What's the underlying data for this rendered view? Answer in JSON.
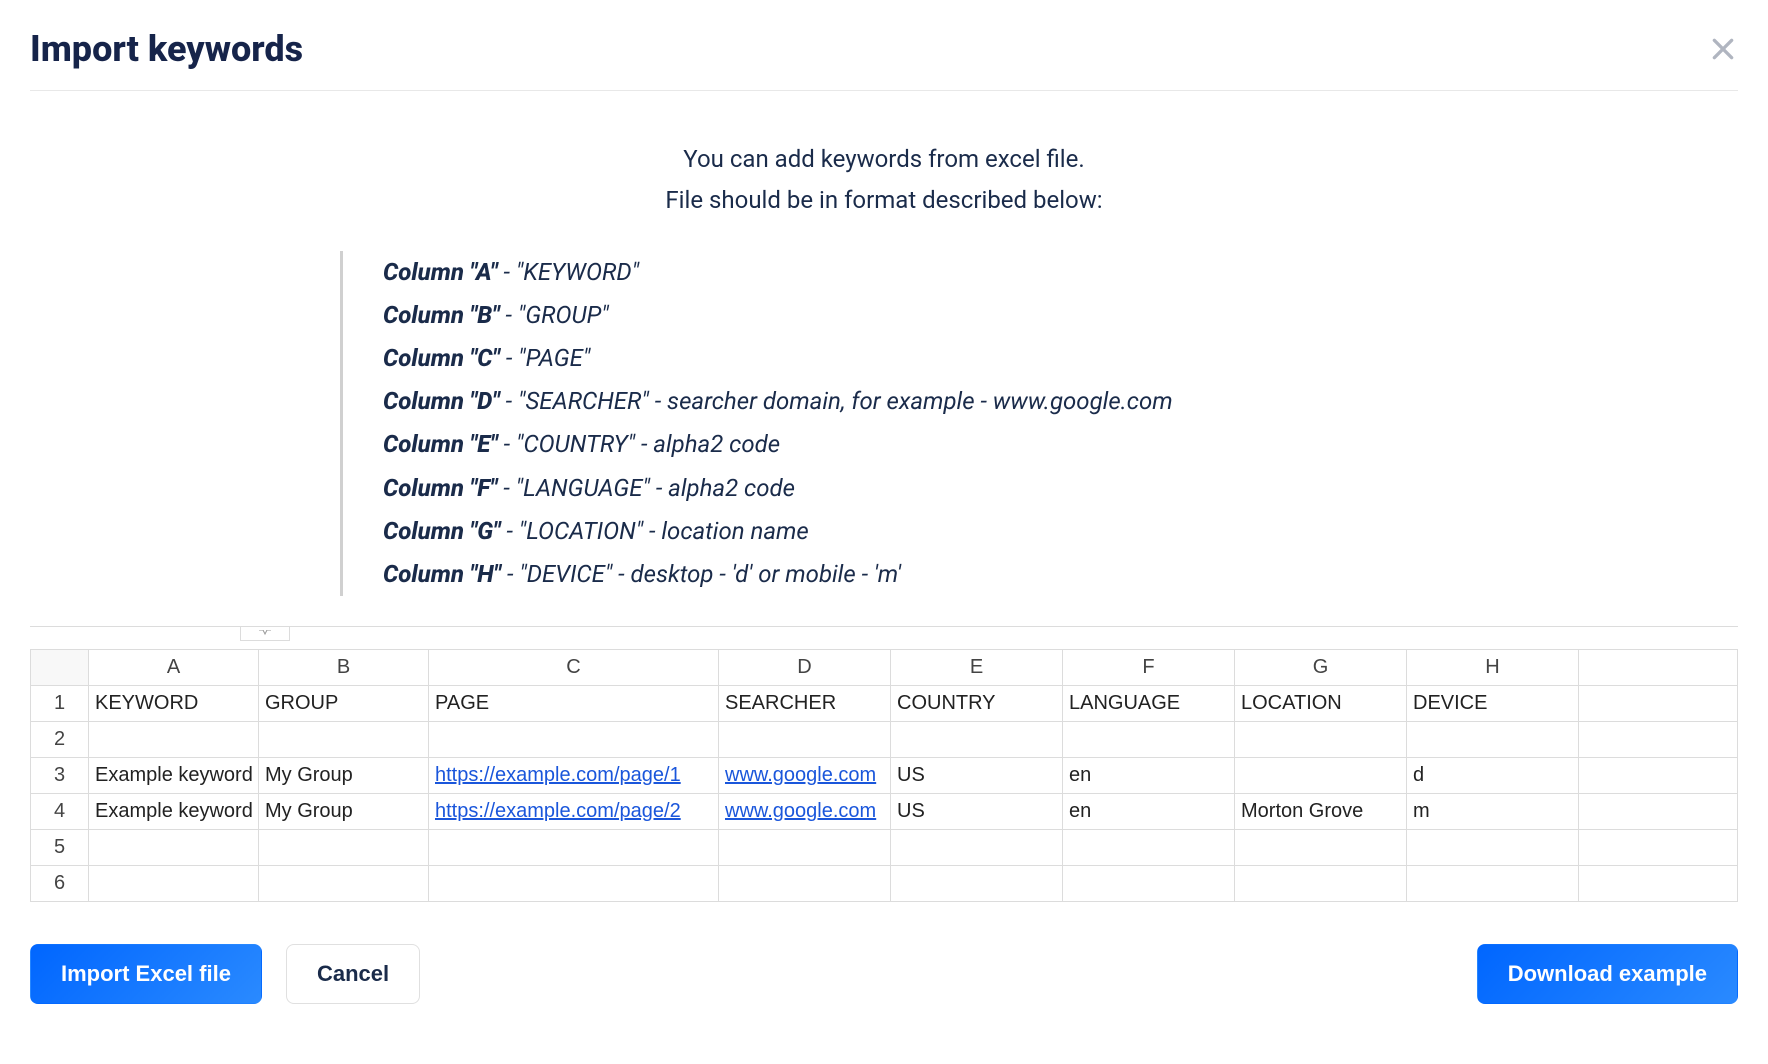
{
  "header": {
    "title": "Import keywords"
  },
  "intro": {
    "line1": "You can add keywords from excel file.",
    "line2": "File should be in format described below:"
  },
  "format": [
    {
      "col": "Column \"A\"",
      "desc": "\"KEYWORD\""
    },
    {
      "col": "Column \"B\"",
      "desc": "\"GROUP\""
    },
    {
      "col": "Column \"C\"",
      "desc": "\"PAGE\""
    },
    {
      "col": "Column \"D\"",
      "desc": "\"SEARCHER\" - searcher domain, for example - www.google.com"
    },
    {
      "col": "Column \"E\"",
      "desc": "\"COUNTRY\" - alpha2 code"
    },
    {
      "col": "Column \"F\"",
      "desc": "\"LANGUAGE\" - alpha2 code"
    },
    {
      "col": "Column \"G\"",
      "desc": "\"LOCATION\" - location name"
    },
    {
      "col": "Column \"H\"",
      "desc": "\"DEVICE\" - desktop - 'd' or mobile - 'm'"
    }
  ],
  "sheet": {
    "colHeaders": [
      "A",
      "B",
      "C",
      "D",
      "E",
      "F",
      "G",
      "H"
    ],
    "rowNums": [
      "1",
      "2",
      "3",
      "4",
      "5",
      "6"
    ],
    "rows": [
      {
        "A": "KEYWORD",
        "B": "GROUP",
        "C": "PAGE",
        "D": "SEARCHER",
        "E": "COUNTRY",
        "F": "LANGUAGE",
        "G": "LOCATION",
        "H": "DEVICE"
      },
      {
        "A": "",
        "B": "",
        "C": "",
        "D": "",
        "E": "",
        "F": "",
        "G": "",
        "H": ""
      },
      {
        "A": "Example keyword",
        "B": "My Group",
        "C": "https://example.com/page/1",
        "D": "www.google.com",
        "E": "US",
        "F": "en",
        "G": "",
        "H": "d",
        "linkC": true,
        "linkD": true
      },
      {
        "A": "Example keyword",
        "B": "My Group",
        "C": "https://example.com/page/2",
        "D": "www.google.com",
        "E": "US",
        "F": "en",
        "G": "Morton Grove",
        "H": "m",
        "linkC": true,
        "linkD": true
      },
      {
        "A": "",
        "B": "",
        "C": "",
        "D": "",
        "E": "",
        "F": "",
        "G": "",
        "H": ""
      },
      {
        "A": "",
        "B": "",
        "C": "",
        "D": "",
        "E": "",
        "F": "",
        "G": "",
        "H": ""
      }
    ],
    "colWidths": {
      "rowhdr": 58,
      "A": 170,
      "B": 170,
      "C": 290,
      "D": 172,
      "E": 172,
      "F": 172,
      "G": 172,
      "H": 172
    }
  },
  "buttons": {
    "import": "Import Excel file",
    "cancel": "Cancel",
    "download": "Download example"
  }
}
